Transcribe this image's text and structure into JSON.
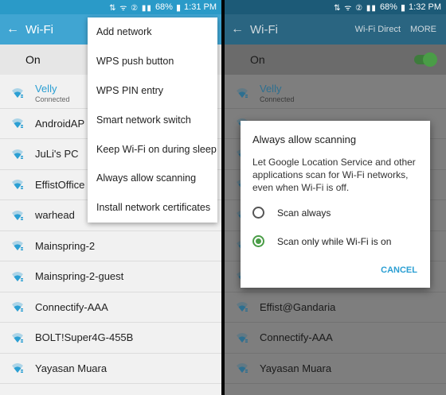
{
  "status": {
    "icons": "⇅ ᯤ ② ▮▮",
    "battery": "68%",
    "time_left": "1:31 PM",
    "time_right": "1:32 PM"
  },
  "app": {
    "title": "Wi-Fi",
    "wifi_direct": "Wi-Fi Direct",
    "more": "MORE"
  },
  "toggle": {
    "label": "On"
  },
  "menu": {
    "items": [
      "Add network",
      "WPS push button",
      "WPS PIN entry",
      "Smart network switch",
      "Keep Wi-Fi on during sleep",
      "Always allow scanning",
      "Install network certificates"
    ]
  },
  "left_networks": [
    {
      "ssid": "Velly",
      "sub": "Connected"
    },
    {
      "ssid": "AndroidAP"
    },
    {
      "ssid": "JuLi's PC"
    },
    {
      "ssid": "EffistOffice"
    },
    {
      "ssid": "warhead"
    },
    {
      "ssid": "Mainspring-2"
    },
    {
      "ssid": "Mainspring-2-guest"
    },
    {
      "ssid": "Connectify-AAA"
    },
    {
      "ssid": "BOLT!Super4G-455B"
    },
    {
      "ssid": "Yayasan Muara"
    }
  ],
  "right_networks": [
    {
      "ssid": "Velly",
      "sub": "Connected"
    },
    {
      "ssid": ""
    },
    {
      "ssid": ""
    },
    {
      "ssid": ""
    },
    {
      "ssid": ""
    },
    {
      "ssid": ""
    },
    {
      "ssid": ""
    },
    {
      "ssid": "Effist@Gandaria"
    },
    {
      "ssid": "Connectify-AAA"
    },
    {
      "ssid": "Yayasan Muara"
    }
  ],
  "dialog": {
    "title": "Always allow scanning",
    "body": "Let Google Location Service and other applications scan for Wi-Fi networks, even when Wi-Fi is off.",
    "option1": "Scan always",
    "option2": "Scan only while Wi-Fi is on",
    "cancel": "CANCEL"
  },
  "colors": {
    "accent": "#40a5d2",
    "toggle_green": "#4a9d47"
  }
}
